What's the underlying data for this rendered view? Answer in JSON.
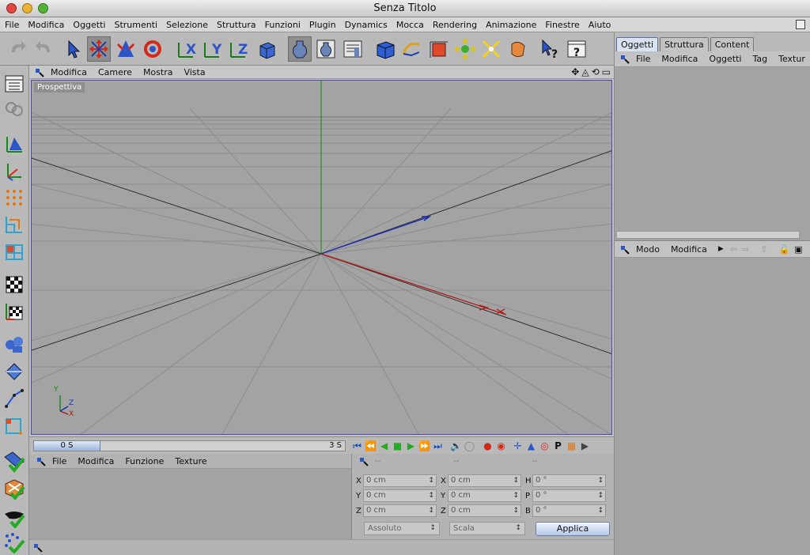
{
  "window": {
    "title": "Senza Titolo"
  },
  "menubar": [
    "File",
    "Modifica",
    "Oggetti",
    "Strumenti",
    "Selezione",
    "Struttura",
    "Funzioni",
    "Plugin",
    "Dynamics",
    "Mocca",
    "Rendering",
    "Animazione",
    "Finestre",
    "Aiuto"
  ],
  "toolbar": {
    "icons": [
      "undo-icon",
      "redo-icon",
      "select-pointer-icon",
      "move-tool-icon",
      "scale-tool-icon",
      "rotate-tool-icon",
      "x-axis-lock-icon",
      "y-axis-lock-icon",
      "z-axis-lock-icon",
      "coordinate-system-icon",
      "render-view-icon",
      "render-picture-icon",
      "render-settings-icon",
      "cube-primitive-icon",
      "spline-icon",
      "nurbs-icon",
      "array-icon",
      "deformer-icon",
      "light-icon",
      "help-pointer-icon",
      "help-menu-icon"
    ]
  },
  "left_tools": {
    "icons": [
      "editor-layout-icon",
      "camera-icon",
      "model-mode-icon",
      "object-axis-icon",
      "points-mode-icon",
      "edges-mode-icon",
      "polygons-mode-icon",
      "texture-mode-icon",
      "texture-axis-icon",
      "bones-icon",
      "brush-icon",
      "inverse-kinematics-icon",
      "animation-mode-icon",
      "plane-check-icon",
      "cube-check-icon",
      "hat-check-icon",
      "particles-check-icon"
    ]
  },
  "viewport": {
    "menu": [
      "Modifica",
      "Camere",
      "Mostra",
      "Vista"
    ],
    "label": "Prospettiva",
    "axis_labels": {
      "y": "Y",
      "z": "Z",
      "x": "X"
    }
  },
  "timeline": {
    "current": "0 S",
    "end": "3 S"
  },
  "material_panel": {
    "menu": [
      "File",
      "Modifica",
      "Funzione",
      "Texture"
    ]
  },
  "coordinates": {
    "headers": [
      "--",
      "--",
      "--"
    ],
    "rows": [
      {
        "l1": "X",
        "v1": "0 cm",
        "l2": "X",
        "v2": "0 cm",
        "l3": "H",
        "v3": "0 °"
      },
      {
        "l1": "Y",
        "v1": "0 cm",
        "l2": "Y",
        "v2": "0 cm",
        "l3": "P",
        "v3": "0 °"
      },
      {
        "l1": "Z",
        "v1": "0 cm",
        "l2": "Z",
        "v2": "0 cm",
        "l3": "B",
        "v3": "0 °"
      }
    ],
    "mode_dropdown": "Assoluto",
    "scale_dropdown": "Scala",
    "apply_button": "Applica"
  },
  "right_panel": {
    "tabs": [
      "Oggetti",
      "Struttura",
      "Content"
    ],
    "object_menu": [
      "File",
      "Modifica",
      "Oggetti",
      "Tag",
      "Textur"
    ],
    "attributes_menu": [
      "Modo",
      "Modifica"
    ]
  },
  "colors": {
    "accent": "#4a4aa8",
    "x_axis": "#b01818",
    "y_axis": "#138a13",
    "z_axis": "#1a2fb0"
  }
}
